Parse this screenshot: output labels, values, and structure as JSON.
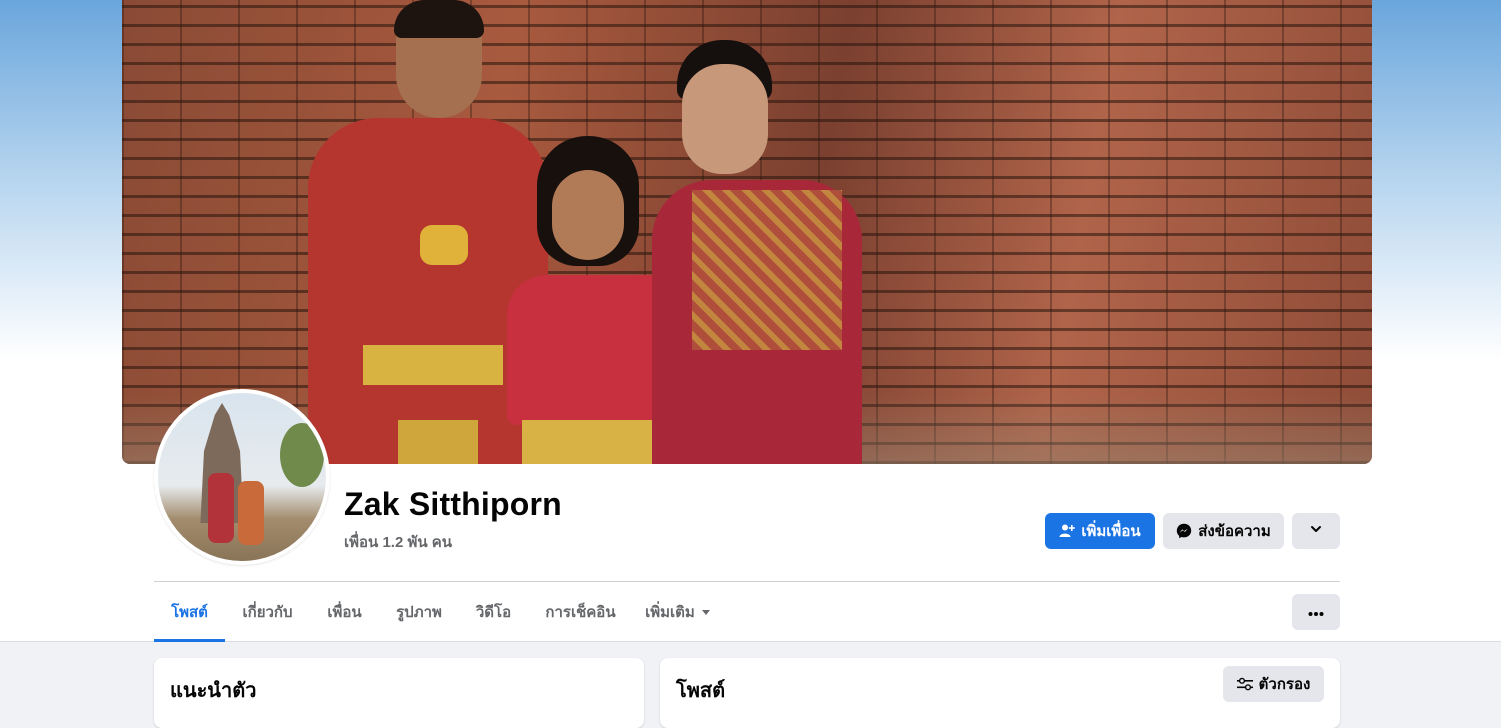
{
  "profile": {
    "name": "Zak Sitthiporn",
    "friends_count": "เพื่อน 1.2 พัน คน"
  },
  "actions": {
    "add_friend": "เพิ่มเพื่อน",
    "message": "ส่งข้อความ"
  },
  "tabs": [
    {
      "label": "โพสต์",
      "active": true
    },
    {
      "label": "เกี่ยวกับ",
      "active": false
    },
    {
      "label": "เพื่อน",
      "active": false
    },
    {
      "label": "รูปภาพ",
      "active": false
    },
    {
      "label": "วิดีโอ",
      "active": false
    },
    {
      "label": "การเช็คอิน",
      "active": false
    },
    {
      "label": "เพิ่มเติม",
      "active": false
    }
  ],
  "intro": {
    "title": "แนะนำตัว"
  },
  "posts": {
    "title": "โพสต์",
    "filter_label": "ตัวกรอง"
  },
  "colors": {
    "accent": "#1b74e4",
    "secondary_button": "#e4e6eb",
    "muted_text": "#65676b",
    "page_bg": "#f0f2f5"
  },
  "icons": {
    "add_friend": "person-plus-icon",
    "message": "messenger-icon",
    "chevron": "chevron-down-icon",
    "more": "more-horizontal-icon",
    "filter": "filter-sliders-icon"
  }
}
